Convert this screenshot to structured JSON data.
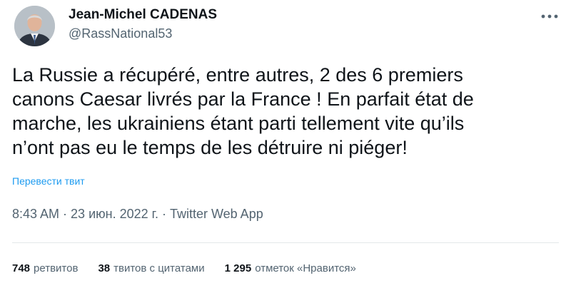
{
  "author": {
    "display_name": "Jean-Michel CADENAS",
    "handle": "@RassNational53"
  },
  "tweet": {
    "lines": [
      "La Russie a récupéré, entre autres, 2 des 6 premiers",
      "canons Caesar livrés par la France ! En parfait état de",
      "marche, les ukrainiens étant parti tellement vite qu’ils",
      "n’ont pas eu le temps de les détruire ni piéger!"
    ],
    "translate_label": "Перевести твит"
  },
  "meta": {
    "time": "8:43 AM",
    "separator1": " · ",
    "date": "23 июн. 2022 г.",
    "separator2": " · ",
    "source": "Twitter Web App"
  },
  "stats": {
    "retweets_count": "748",
    "retweets_label": "ретвитов",
    "quotes_count": "38",
    "quotes_label": "твитов с цитатами",
    "likes_count": "1 295",
    "likes_label": "отметок «Нравится»"
  },
  "icons": {
    "more": "more-horizontal-icon"
  },
  "colors": {
    "link": "#1d9bf0",
    "secondary_text": "#536471",
    "primary_text": "#0f1419"
  }
}
